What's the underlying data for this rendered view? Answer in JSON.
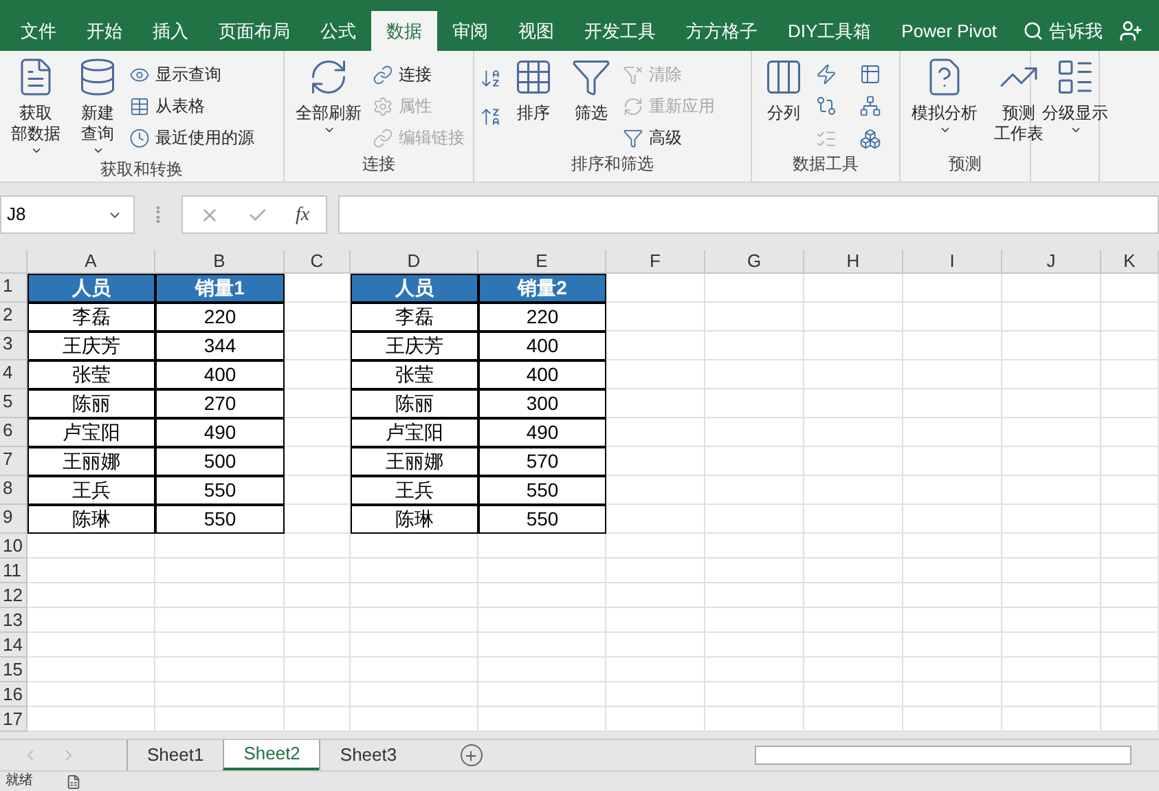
{
  "tabs": [
    {
      "label": "文件",
      "selected": false
    },
    {
      "label": "开始",
      "selected": false
    },
    {
      "label": "插入",
      "selected": false
    },
    {
      "label": "页面布局",
      "selected": false
    },
    {
      "label": "公式",
      "selected": false
    },
    {
      "label": "数据",
      "selected": true
    },
    {
      "label": "审阅",
      "selected": false
    },
    {
      "label": "视图",
      "selected": false
    },
    {
      "label": "开发工具",
      "selected": false
    },
    {
      "label": "方方格子",
      "selected": false
    },
    {
      "label": "DIY工具箱",
      "selected": false
    },
    {
      "label": "Power Pivot",
      "selected": false
    }
  ],
  "tell_me": "告诉我",
  "ribbon": [
    {
      "label": "获取和转换",
      "items": [
        {
          "kind": "large",
          "lines": [
            "获取",
            "部数据"
          ],
          "dropdown": true,
          "disabled": false
        },
        {
          "kind": "large",
          "lines": [
            "新建",
            "查询"
          ],
          "dropdown": true,
          "disabled": false
        },
        {
          "kind": "small",
          "lines": [
            "显示查询"
          ],
          "disabled": false
        },
        {
          "kind": "small",
          "lines": [
            "从表格"
          ],
          "disabled": false
        },
        {
          "kind": "small",
          "lines": [
            "最近使用的源"
          ],
          "disabled": false
        }
      ]
    },
    {
      "label": "连接",
      "items": [
        {
          "kind": "large",
          "lines": [
            "全部刷新"
          ],
          "dropdown": true,
          "disabled": false
        },
        {
          "kind": "small",
          "lines": [
            "连接"
          ],
          "disabled": false
        },
        {
          "kind": "small",
          "lines": [
            "属性"
          ],
          "disabled": true
        },
        {
          "kind": "small",
          "lines": [
            "编辑链接"
          ],
          "disabled": true
        }
      ]
    },
    {
      "label": "排序和筛选",
      "items": [
        {
          "kind": "icon",
          "disabled": false
        },
        {
          "kind": "icon",
          "disabled": false
        },
        {
          "kind": "large",
          "lines": [
            "排序"
          ],
          "dropdown": false,
          "disabled": false
        },
        {
          "kind": "large",
          "lines": [
            "筛选"
          ],
          "dropdown": false,
          "disabled": false
        },
        {
          "kind": "small",
          "lines": [
            "清除"
          ],
          "disabled": true
        },
        {
          "kind": "small",
          "lines": [
            "重新应用"
          ],
          "disabled": true
        },
        {
          "kind": "small",
          "lines": [
            "高级"
          ],
          "disabled": false
        }
      ]
    },
    {
      "label": "数据工具",
      "items": [
        {
          "kind": "large",
          "lines": [
            "分列"
          ],
          "dropdown": false,
          "disabled": false
        },
        {
          "kind": "icon",
          "disabled": false
        },
        {
          "kind": "icon",
          "disabled": false
        },
        {
          "kind": "icon",
          "disabled": false
        },
        {
          "kind": "icon",
          "disabled": false
        },
        {
          "kind": "icon",
          "disabled": true
        },
        {
          "kind": "icon",
          "disabled": false
        }
      ]
    },
    {
      "label": "预测",
      "items": [
        {
          "kind": "large",
          "lines": [
            "模拟分析"
          ],
          "dropdown": true,
          "disabled": false
        },
        {
          "kind": "large",
          "lines": [
            "预测",
            "工作表"
          ],
          "dropdown": false,
          "disabled": false
        }
      ]
    },
    {
      "items": [
        {
          "kind": "large",
          "lines": [
            "分级显示"
          ],
          "dropdown": true,
          "disabled": false
        }
      ]
    }
  ],
  "formula_bar": {
    "name_box": "J8",
    "fx": "fx"
  },
  "columns": [
    "A",
    "B",
    "C",
    "D",
    "E",
    "F",
    "G",
    "H",
    "I",
    "J",
    "K"
  ],
  "rows": [
    "1",
    "2",
    "3",
    "4",
    "5",
    "6",
    "7",
    "8",
    "9",
    "10",
    "11",
    "12",
    "13",
    "14",
    "15",
    "16",
    "17"
  ],
  "tables": [
    {
      "header": [
        "人员",
        "销量1"
      ],
      "rows": [
        [
          "李磊",
          "220"
        ],
        [
          "王庆芳",
          "344"
        ],
        [
          "张莹",
          "400"
        ],
        [
          "陈丽",
          "270"
        ],
        [
          "卢宝阳",
          "490"
        ],
        [
          "王丽娜",
          "500"
        ],
        [
          "王兵",
          "550"
        ],
        [
          "陈琳",
          "550"
        ]
      ]
    },
    {
      "header": [
        "人员",
        "销量2"
      ],
      "rows": [
        [
          "李磊",
          "220"
        ],
        [
          "王庆芳",
          "400"
        ],
        [
          "张莹",
          "400"
        ],
        [
          "陈丽",
          "300"
        ],
        [
          "卢宝阳",
          "490"
        ],
        [
          "王丽娜",
          "570"
        ],
        [
          "王兵",
          "550"
        ],
        [
          "陈琳",
          "550"
        ]
      ]
    }
  ],
  "sheets": [
    {
      "label": "Sheet1",
      "selected": false
    },
    {
      "label": "Sheet2",
      "selected": true
    },
    {
      "label": "Sheet3",
      "selected": false
    }
  ],
  "status": "就绪"
}
